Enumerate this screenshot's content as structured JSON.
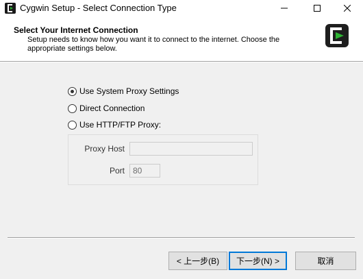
{
  "window": {
    "title": "Cygwin Setup - Select Connection Type",
    "controls": {
      "minimize": "—",
      "maximize": "☐",
      "close": "✕"
    }
  },
  "header": {
    "title": "Select Your Internet Connection",
    "description": "Setup needs to know how you want it to connect to the internet.  Choose the appropriate settings below.",
    "logo": "cygwin-logo-icon"
  },
  "options": {
    "system_proxy": {
      "label": "Use System Proxy Settings",
      "checked": true
    },
    "direct": {
      "label": "Direct Connection",
      "checked": false
    },
    "http_ftp": {
      "label": "Use HTTP/FTP Proxy:",
      "checked": false
    }
  },
  "proxy": {
    "host_label": "Proxy Host",
    "host_value": "",
    "port_label": "Port",
    "port_value": "80"
  },
  "buttons": {
    "back": "< 上一步(B)",
    "next": "下一步(N) >",
    "cancel": "取消"
  },
  "colors": {
    "cygwin_green": "#2db432",
    "focus_blue": "#0078d7"
  }
}
